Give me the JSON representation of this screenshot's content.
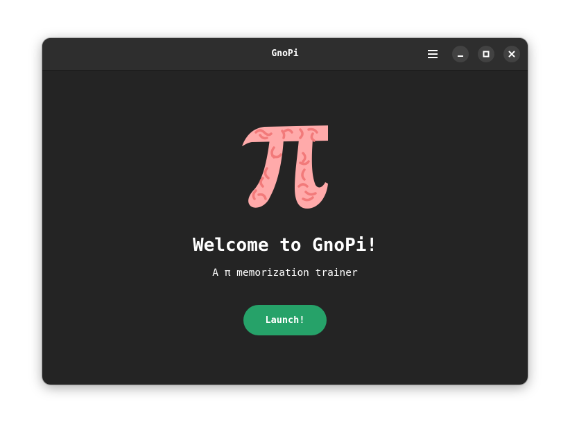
{
  "window": {
    "title": "GnoPi"
  },
  "headerbar": {
    "menu_icon": "hamburger-menu-icon",
    "minimize_icon": "minimize-icon",
    "maximize_icon": "maximize-icon",
    "close_icon": "close-icon"
  },
  "main": {
    "logo_icon": "pi-symbol-icon",
    "title": "Welcome to GnoPi!",
    "subtitle": "A π memorization trainer",
    "launch_label": "Launch!"
  },
  "colors": {
    "window_bg": "#242424",
    "headerbar_bg": "#2e2e2e",
    "accent_green": "#26a269",
    "logo_pink": "#ffaaaa",
    "logo_veins": "#f27a7a"
  }
}
